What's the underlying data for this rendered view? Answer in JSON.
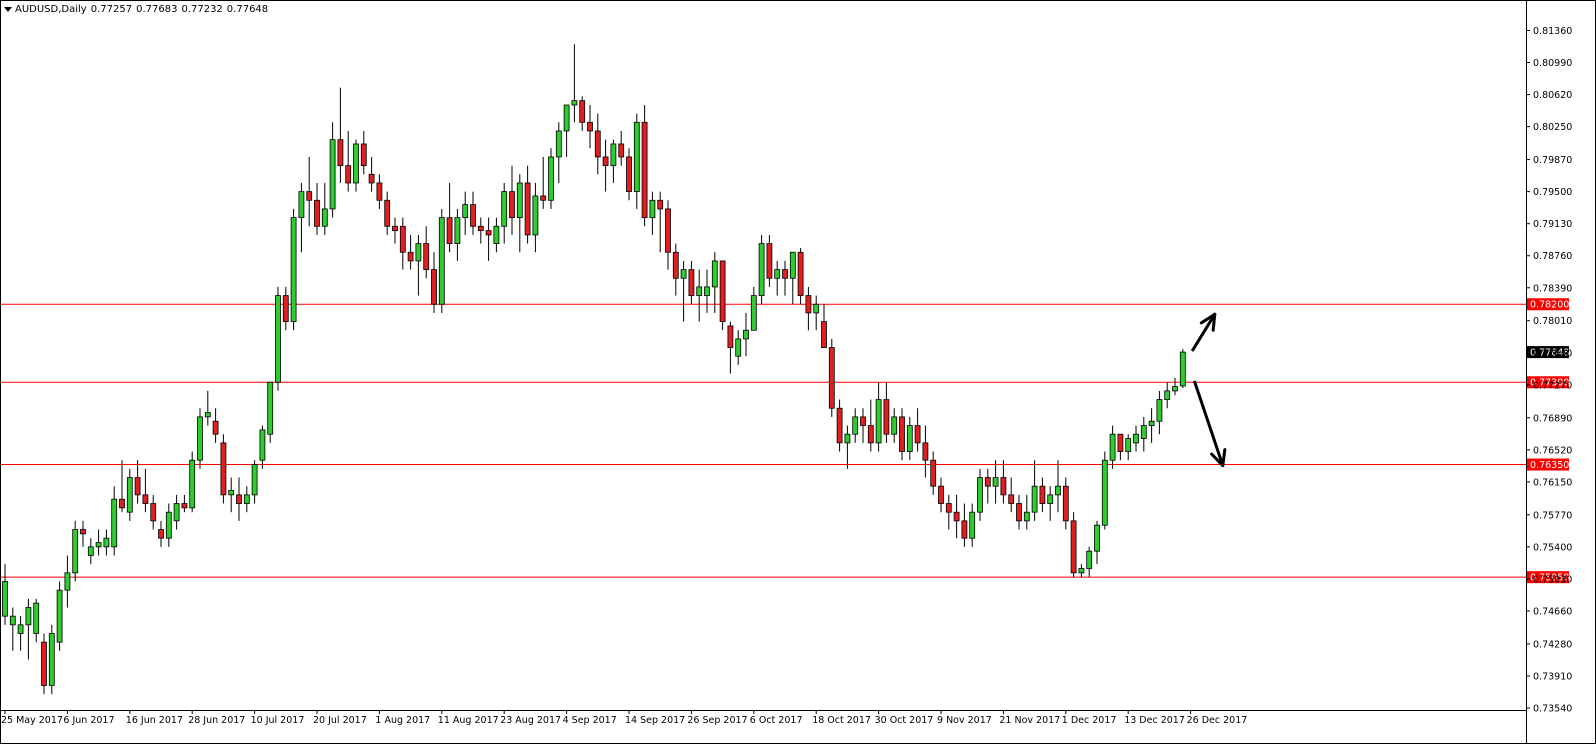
{
  "header": {
    "symbol": "AUDUSD,Daily",
    "open": "0.77257",
    "high": "0.77683",
    "low": "0.77232",
    "close": "0.77648"
  },
  "chart_data": {
    "type": "candlestick",
    "ylim": [
      0.7354,
      0.8155
    ],
    "y_ticks": [
      "0.81360",
      "0.80990",
      "0.80620",
      "0.80250",
      "0.79870",
      "0.79500",
      "0.79130",
      "0.78760",
      "0.78390",
      "0.78010",
      "0.77640",
      "0.77270",
      "0.76890",
      "0.76520",
      "0.76150",
      "0.75770",
      "0.75400",
      "0.75030",
      "0.74660",
      "0.74280",
      "0.73910",
      "0.73540"
    ],
    "x_labels": [
      "25 May 2017",
      "6 Jun 2017",
      "16 Jun 2017",
      "28 Jun 2017",
      "10 Jul 2017",
      "20 Jul 2017",
      "1 Aug 2017",
      "11 Aug 2017",
      "23 Aug 2017",
      "4 Sep 2017",
      "14 Sep 2017",
      "26 Sep 2017",
      "6 Oct 2017",
      "18 Oct 2017",
      "30 Oct 2017",
      "9 Nov 2017",
      "21 Nov 2017",
      "1 Dec 2017",
      "13 Dec 2017",
      "26 Dec 2017"
    ],
    "x_label_index": [
      0,
      8,
      16,
      24,
      32,
      40,
      48,
      56,
      64,
      72,
      80,
      88,
      96,
      104,
      112,
      120,
      128,
      136,
      144,
      152
    ],
    "horizontal_levels": [
      {
        "value": 0.782,
        "label": "0.78200"
      },
      {
        "value": 0.773,
        "label": "0.77300"
      },
      {
        "value": 0.7635,
        "label": "0.76350"
      },
      {
        "value": 0.7505,
        "label": "0.75050"
      }
    ],
    "current_price": {
      "value": 0.77648,
      "label": "0.77648"
    },
    "candles": [
      [
        0.746,
        0.752,
        0.745,
        0.75
      ],
      [
        0.745,
        0.747,
        0.742,
        0.746
      ],
      [
        0.744,
        0.746,
        0.742,
        0.745
      ],
      [
        0.745,
        0.748,
        0.741,
        0.747
      ],
      [
        0.744,
        0.748,
        0.743,
        0.7475
      ],
      [
        0.743,
        0.744,
        0.737,
        0.738
      ],
      [
        0.738,
        0.745,
        0.737,
        0.744
      ],
      [
        0.743,
        0.75,
        0.742,
        0.749
      ],
      [
        0.749,
        0.753,
        0.747,
        0.751
      ],
      [
        0.751,
        0.757,
        0.75,
        0.756
      ],
      [
        0.756,
        0.757,
        0.754,
        0.7555
      ],
      [
        0.753,
        0.755,
        0.752,
        0.754
      ],
      [
        0.754,
        0.756,
        0.753,
        0.7545
      ],
      [
        0.754,
        0.756,
        0.753,
        0.755
      ],
      [
        0.754,
        0.761,
        0.753,
        0.7595
      ],
      [
        0.7595,
        0.764,
        0.758,
        0.7585
      ],
      [
        0.758,
        0.763,
        0.757,
        0.762
      ],
      [
        0.762,
        0.764,
        0.759,
        0.76
      ],
      [
        0.76,
        0.763,
        0.758,
        0.759
      ],
      [
        0.759,
        0.76,
        0.756,
        0.757
      ],
      [
        0.756,
        0.757,
        0.754,
        0.755
      ],
      [
        0.755,
        0.759,
        0.754,
        0.758
      ],
      [
        0.757,
        0.76,
        0.756,
        0.759
      ],
      [
        0.759,
        0.76,
        0.758,
        0.7585
      ],
      [
        0.7585,
        0.765,
        0.758,
        0.764
      ],
      [
        0.764,
        0.77,
        0.763,
        0.769
      ],
      [
        0.769,
        0.772,
        0.768,
        0.7695
      ],
      [
        0.7685,
        0.77,
        0.766,
        0.767
      ],
      [
        0.766,
        0.767,
        0.759,
        0.76
      ],
      [
        0.76,
        0.762,
        0.758,
        0.7605
      ],
      [
        0.76,
        0.762,
        0.757,
        0.759
      ],
      [
        0.759,
        0.761,
        0.758,
        0.76
      ],
      [
        0.76,
        0.764,
        0.759,
        0.7635
      ],
      [
        0.764,
        0.768,
        0.763,
        0.7675
      ],
      [
        0.767,
        0.773,
        0.766,
        0.773
      ],
      [
        0.773,
        0.784,
        0.772,
        0.783
      ],
      [
        0.783,
        0.784,
        0.779,
        0.78
      ],
      [
        0.78,
        0.793,
        0.779,
        0.792
      ],
      [
        0.792,
        0.796,
        0.788,
        0.795
      ],
      [
        0.795,
        0.799,
        0.791,
        0.794
      ],
      [
        0.794,
        0.796,
        0.79,
        0.791
      ],
      [
        0.791,
        0.796,
        0.79,
        0.793
      ],
      [
        0.793,
        0.803,
        0.792,
        0.801
      ],
      [
        0.801,
        0.807,
        0.796,
        0.798
      ],
      [
        0.798,
        0.802,
        0.795,
        0.796
      ],
      [
        0.796,
        0.801,
        0.795,
        0.8005
      ],
      [
        0.8005,
        0.802,
        0.797,
        0.798
      ],
      [
        0.797,
        0.799,
        0.795,
        0.796
      ],
      [
        0.796,
        0.797,
        0.793,
        0.794
      ],
      [
        0.794,
        0.795,
        0.79,
        0.791
      ],
      [
        0.791,
        0.792,
        0.789,
        0.7905
      ],
      [
        0.791,
        0.792,
        0.786,
        0.788
      ],
      [
        0.788,
        0.79,
        0.786,
        0.787
      ],
      [
        0.787,
        0.79,
        0.783,
        0.789
      ],
      [
        0.789,
        0.791,
        0.785,
        0.786
      ],
      [
        0.786,
        0.788,
        0.781,
        0.782
      ],
      [
        0.782,
        0.793,
        0.781,
        0.792
      ],
      [
        0.792,
        0.796,
        0.788,
        0.789
      ],
      [
        0.789,
        0.793,
        0.787,
        0.792
      ],
      [
        0.792,
        0.795,
        0.79,
        0.7935
      ],
      [
        0.7935,
        0.795,
        0.79,
        0.791
      ],
      [
        0.791,
        0.792,
        0.789,
        0.7905
      ],
      [
        0.7905,
        0.792,
        0.787,
        0.79
      ],
      [
        0.789,
        0.792,
        0.788,
        0.791
      ],
      [
        0.791,
        0.796,
        0.789,
        0.795
      ],
      [
        0.795,
        0.798,
        0.79,
        0.792
      ],
      [
        0.792,
        0.797,
        0.788,
        0.796
      ],
      [
        0.796,
        0.798,
        0.789,
        0.79
      ],
      [
        0.79,
        0.796,
        0.788,
        0.7945
      ],
      [
        0.7945,
        0.799,
        0.793,
        0.794
      ],
      [
        0.794,
        0.8,
        0.793,
        0.799
      ],
      [
        0.799,
        0.803,
        0.796,
        0.802
      ],
      [
        0.802,
        0.805,
        0.799,
        0.805
      ],
      [
        0.805,
        0.812,
        0.803,
        0.8055
      ],
      [
        0.8055,
        0.806,
        0.802,
        0.803
      ],
      [
        0.803,
        0.805,
        0.8,
        0.802
      ],
      [
        0.802,
        0.804,
        0.797,
        0.799
      ],
      [
        0.799,
        0.801,
        0.795,
        0.798
      ],
      [
        0.798,
        0.801,
        0.796,
        0.8005
      ],
      [
        0.8005,
        0.802,
        0.798,
        0.799
      ],
      [
        0.799,
        0.8,
        0.794,
        0.795
      ],
      [
        0.795,
        0.804,
        0.793,
        0.803
      ],
      [
        0.803,
        0.805,
        0.791,
        0.792
      ],
      [
        0.792,
        0.795,
        0.79,
        0.794
      ],
      [
        0.794,
        0.795,
        0.788,
        0.793
      ],
      [
        0.793,
        0.794,
        0.786,
        0.788
      ],
      [
        0.788,
        0.789,
        0.783,
        0.785
      ],
      [
        0.785,
        0.787,
        0.78,
        0.786
      ],
      [
        0.786,
        0.787,
        0.782,
        0.783
      ],
      [
        0.783,
        0.786,
        0.78,
        0.784
      ],
      [
        0.783,
        0.786,
        0.781,
        0.784
      ],
      [
        0.784,
        0.788,
        0.781,
        0.787
      ],
      [
        0.787,
        0.787,
        0.779,
        0.78
      ],
      [
        0.7795,
        0.78,
        0.774,
        0.777
      ],
      [
        0.776,
        0.779,
        0.775,
        0.778
      ],
      [
        0.778,
        0.781,
        0.776,
        0.779
      ],
      [
        0.779,
        0.784,
        0.779,
        0.783
      ],
      [
        0.783,
        0.79,
        0.782,
        0.789
      ],
      [
        0.789,
        0.79,
        0.784,
        0.785
      ],
      [
        0.785,
        0.787,
        0.783,
        0.786
      ],
      [
        0.786,
        0.787,
        0.783,
        0.785
      ],
      [
        0.785,
        0.788,
        0.782,
        0.788
      ],
      [
        0.788,
        0.7885,
        0.782,
        0.783
      ],
      [
        0.783,
        0.784,
        0.779,
        0.781
      ],
      [
        0.781,
        0.783,
        0.779,
        0.782
      ],
      [
        0.78,
        0.782,
        0.777,
        0.777
      ],
      [
        0.777,
        0.778,
        0.769,
        0.77
      ],
      [
        0.77,
        0.771,
        0.765,
        0.766
      ],
      [
        0.766,
        0.768,
        0.763,
        0.767
      ],
      [
        0.767,
        0.77,
        0.766,
        0.769
      ],
      [
        0.769,
        0.77,
        0.766,
        0.768
      ],
      [
        0.768,
        0.771,
        0.765,
        0.766
      ],
      [
        0.766,
        0.773,
        0.765,
        0.771
      ],
      [
        0.771,
        0.773,
        0.766,
        0.767
      ],
      [
        0.767,
        0.77,
        0.766,
        0.769
      ],
      [
        0.769,
        0.77,
        0.764,
        0.765
      ],
      [
        0.765,
        0.769,
        0.764,
        0.768
      ],
      [
        0.768,
        0.77,
        0.765,
        0.766
      ],
      [
        0.766,
        0.768,
        0.762,
        0.764
      ],
      [
        0.764,
        0.765,
        0.76,
        0.761
      ],
      [
        0.761,
        0.762,
        0.758,
        0.759
      ],
      [
        0.759,
        0.76,
        0.756,
        0.758
      ],
      [
        0.758,
        0.76,
        0.755,
        0.757
      ],
      [
        0.757,
        0.759,
        0.754,
        0.755
      ],
      [
        0.755,
        0.759,
        0.754,
        0.758
      ],
      [
        0.758,
        0.763,
        0.757,
        0.762
      ],
      [
        0.762,
        0.763,
        0.759,
        0.761
      ],
      [
        0.761,
        0.764,
        0.759,
        0.762
      ],
      [
        0.762,
        0.764,
        0.759,
        0.76
      ],
      [
        0.76,
        0.762,
        0.758,
        0.759
      ],
      [
        0.759,
        0.76,
        0.756,
        0.757
      ],
      [
        0.757,
        0.76,
        0.756,
        0.758
      ],
      [
        0.758,
        0.764,
        0.757,
        0.761
      ],
      [
        0.761,
        0.762,
        0.758,
        0.759
      ],
      [
        0.759,
        0.761,
        0.757,
        0.76
      ],
      [
        0.76,
        0.764,
        0.758,
        0.761
      ],
      [
        0.761,
        0.762,
        0.756,
        0.757
      ],
      [
        0.757,
        0.758,
        0.7505,
        0.751
      ],
      [
        0.751,
        0.752,
        0.7505,
        0.7515
      ],
      [
        0.7515,
        0.754,
        0.7505,
        0.7535
      ],
      [
        0.7535,
        0.757,
        0.752,
        0.7565
      ],
      [
        0.7565,
        0.765,
        0.756,
        0.764
      ],
      [
        0.764,
        0.768,
        0.763,
        0.767
      ],
      [
        0.767,
        0.767,
        0.764,
        0.765
      ],
      [
        0.765,
        0.767,
        0.764,
        0.7665
      ],
      [
        0.766,
        0.768,
        0.765,
        0.767
      ],
      [
        0.7665,
        0.769,
        0.765,
        0.768
      ],
      [
        0.768,
        0.77,
        0.766,
        0.7685
      ],
      [
        0.7685,
        0.772,
        0.767,
        0.771
      ],
      [
        0.771,
        0.773,
        0.77,
        0.772
      ],
      [
        0.772,
        0.7735,
        0.7715,
        0.7725
      ],
      [
        0.77257,
        0.77683,
        0.77232,
        0.77648
      ]
    ],
    "colors": {
      "bull": "#2ecc2e",
      "bear": "#e02020",
      "level": "#ff0000",
      "axis": "#000000"
    }
  }
}
